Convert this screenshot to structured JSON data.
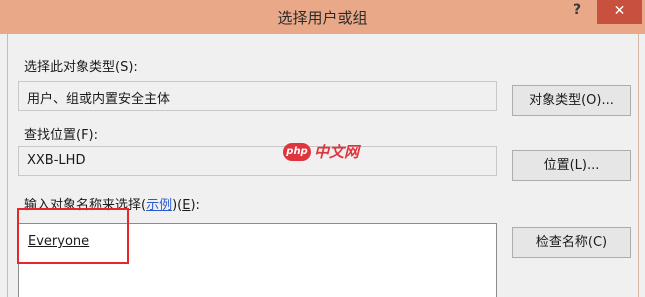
{
  "window": {
    "title": "选择用户或组",
    "help": "?",
    "close": "✕"
  },
  "object_type": {
    "label": "选择此对象类型(S):",
    "value": "用户、组或内置安全主体",
    "button": "对象类型(O)..."
  },
  "location": {
    "label": "查找位置(F):",
    "value": "XXB-LHD",
    "button": "位置(L)..."
  },
  "names": {
    "label_prefix": "输入对象名称来选择(",
    "label_link": "示例",
    "label_mid": ")(",
    "label_accel": "E",
    "label_suffix": "):",
    "entry": "Everyone",
    "check_button": "检查名称(C)"
  },
  "watermark": {
    "logo": "php",
    "text": "中文网"
  },
  "colors": {
    "titlebar": "#e9a988",
    "close_button": "#c7503e",
    "highlight_box": "#e5262a",
    "link": "#2a5bd7"
  }
}
